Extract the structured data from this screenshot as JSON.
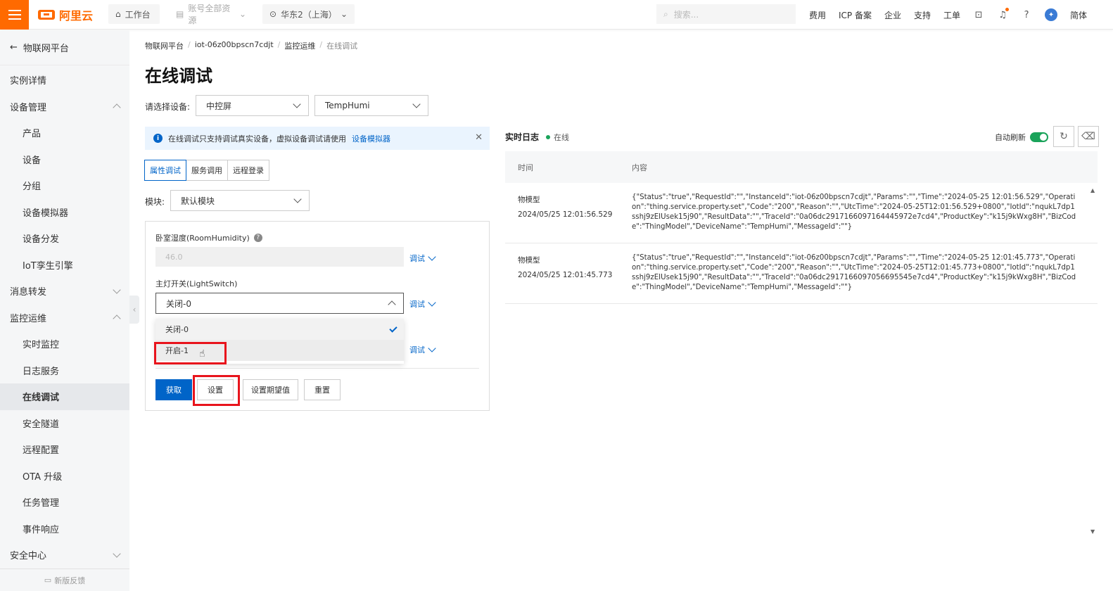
{
  "topbar": {
    "logo_text": "阿里云",
    "workbench": "工作台",
    "resources": "账号全部资源",
    "region": "华东2（上海）",
    "search_placeholder": "搜索...",
    "links": [
      "费用",
      "ICP 备案",
      "企业",
      "支持",
      "工单"
    ],
    "lang": "简体",
    "brand_color": "#ff6a00"
  },
  "sidebar": {
    "back_label": "物联网平台",
    "items": [
      {
        "label": "实例详情",
        "sub": false
      },
      {
        "label": "设备管理",
        "sub": false,
        "chevron": "up"
      },
      {
        "label": "产品",
        "sub": true
      },
      {
        "label": "设备",
        "sub": true
      },
      {
        "label": "分组",
        "sub": true
      },
      {
        "label": "设备模拟器",
        "sub": true
      },
      {
        "label": "设备分发",
        "sub": true
      },
      {
        "label": "IoT孪生引擎",
        "sub": true
      },
      {
        "label": "消息转发",
        "sub": false,
        "chevron": "down"
      },
      {
        "label": "监控运维",
        "sub": false,
        "chevron": "up"
      },
      {
        "label": "实时监控",
        "sub": true
      },
      {
        "label": "日志服务",
        "sub": true
      },
      {
        "label": "在线调试",
        "sub": true,
        "active": true
      },
      {
        "label": "安全隧道",
        "sub": true
      },
      {
        "label": "远程配置",
        "sub": true
      },
      {
        "label": "OTA 升级",
        "sub": true
      },
      {
        "label": "任务管理",
        "sub": true
      },
      {
        "label": "事件响应",
        "sub": true
      },
      {
        "label": "安全中心",
        "sub": false,
        "chevron": "down"
      }
    ],
    "feedback": "新版反馈"
  },
  "breadcrumb": [
    "物联网平台",
    "iot-06z00bpscn7cdjt",
    "监控运维",
    "在线调试"
  ],
  "page_title": "在线调试",
  "device_select": {
    "label": "请选择设备:",
    "product": "中控屏",
    "device": "TempHumi"
  },
  "notice": {
    "text": "在线调试只支持调试真实设备，虚拟设备调试请使用",
    "link": "设备模拟器"
  },
  "tabs": [
    "属性调试",
    "服务调用",
    "远程登录"
  ],
  "module": {
    "label": "模块:",
    "value": "默认模块"
  },
  "fields": {
    "humidity_label": "卧室湿度(RoomHumidity)",
    "humidity_value": "46.0",
    "light_label": "主灯开关(LightSwitch)",
    "light_value": "关闭-0",
    "debug": "调试"
  },
  "dropdown_options": [
    "关闭-0",
    "开启-1"
  ],
  "buttons": {
    "get": "获取",
    "set": "设置",
    "set_expected": "设置期望值",
    "reset": "重置"
  },
  "log": {
    "title": "实时日志",
    "status": "在线",
    "auto_refresh": "自动刷新",
    "col_time": "时间",
    "col_content": "内容",
    "rows": [
      {
        "type": "物模型",
        "time": "2024/05/25 12:01:56.529",
        "content": "{\"Status\":\"true\",\"RequestId\":\"\",\"InstanceId\":\"iot-06z00bpscn7cdjt\",\"Params\":\"\",\"Time\":\"2024-05-25 12:01:56.529\",\"Operation\":\"thing.service.property.set\",\"Code\":\"200\",\"Reason\":\"\",\"UtcTime\":\"2024-05-25T12:01:56.529+0800\",\"IotId\":\"nqukL7dp1sshj9zEIUsek15j90\",\"ResultData\":\"\",\"TraceId\":\"0a06dc2917166097164445972e7cd4\",\"ProductKey\":\"k15j9kWxg8H\",\"BizCode\":\"ThingModel\",\"DeviceName\":\"TempHumi\",\"MessageId\":\"\"}"
      },
      {
        "type": "物模型",
        "time": "2024/05/25 12:01:45.773",
        "content": "{\"Status\":\"true\",\"RequestId\":\"\",\"InstanceId\":\"iot-06z00bpscn7cdjt\",\"Params\":\"\",\"Time\":\"2024-05-25 12:01:45.773\",\"Operation\":\"thing.service.property.set\",\"Code\":\"200\",\"Reason\":\"\",\"UtcTime\":\"2024-05-25T12:01:45.773+0800\",\"IotId\":\"nqukL7dp1sshj9zEIUsek15j90\",\"ResultData\":\"\",\"TraceId\":\"0a06dc2917166097056695545e7cd4\",\"ProductKey\":\"k15j9kWxg8H\",\"BizCode\":\"ThingModel\",\"DeviceName\":\"TempHumi\",\"MessageId\":\"\"}"
      }
    ]
  }
}
